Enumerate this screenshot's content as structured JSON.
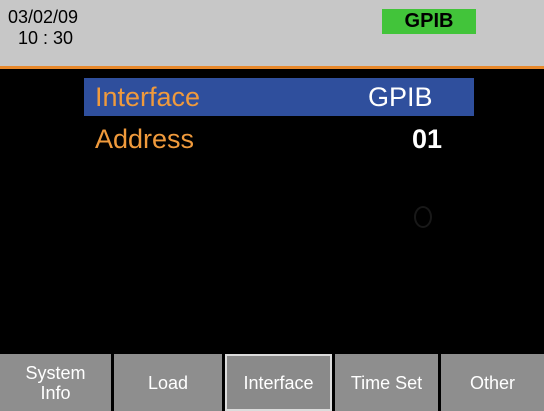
{
  "header": {
    "date": "03/02/09",
    "time": "10 : 30",
    "interface_badge": "GPIB",
    "badge_color": "#42c43a",
    "accent_line_color": "#e8892c"
  },
  "menu": {
    "rows": [
      {
        "label": "Interface",
        "value": "GPIB",
        "selected": true
      },
      {
        "label": "Address",
        "value": "01",
        "selected": false
      }
    ],
    "label_color": "#f09a3c",
    "selected_row_color": "#2f4f9d"
  },
  "softkeys": [
    {
      "line1": "System",
      "line2": "Info",
      "active": false
    },
    {
      "line1": "Load",
      "line2": "",
      "active": false
    },
    {
      "line1": "Interface",
      "line2": "",
      "active": true
    },
    {
      "line1": "Time Set",
      "line2": "",
      "active": false
    },
    {
      "line1": "Other",
      "line2": "",
      "active": false
    }
  ]
}
